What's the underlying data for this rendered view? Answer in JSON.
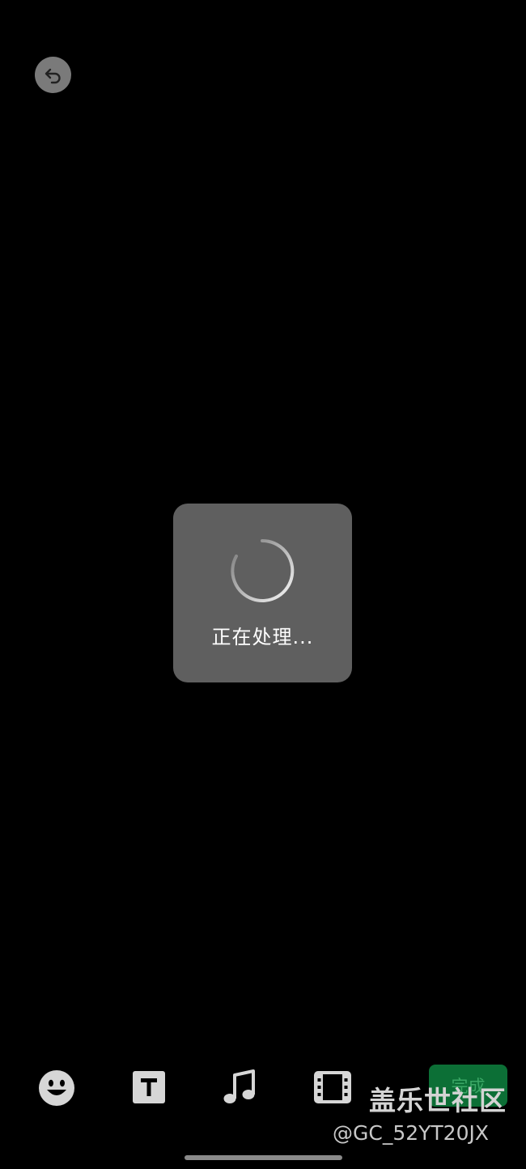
{
  "loading": {
    "text": "正在处理..."
  },
  "toolbar": {
    "items": [
      {
        "icon": "emoji-icon"
      },
      {
        "icon": "text-icon"
      },
      {
        "icon": "music-icon"
      },
      {
        "icon": "film-icon"
      }
    ],
    "done_label": "完成"
  },
  "watermark": {
    "main": "盖乐世社区",
    "sub": "@GC_52YT20JX"
  },
  "colors": {
    "background": "#000000",
    "toast": "#5f5f5f",
    "icon": "#d6d6d6",
    "done_button": "#0c6f36"
  }
}
